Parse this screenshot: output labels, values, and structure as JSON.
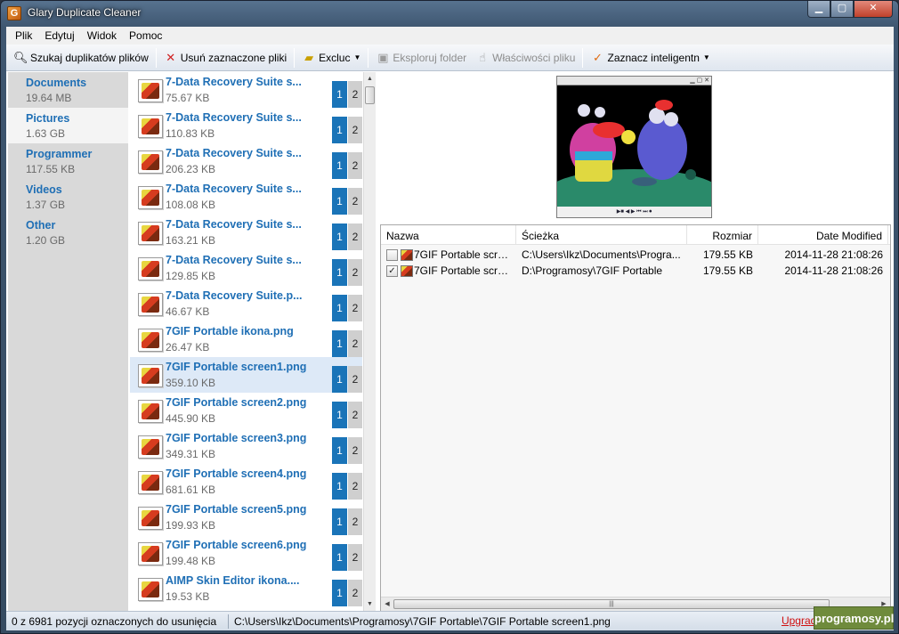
{
  "window": {
    "title": "Glary Duplicate Cleaner",
    "icon": "app-icon"
  },
  "menu": [
    "Plik",
    "Edytuj",
    "Widok",
    "Pomoc"
  ],
  "toolbar": {
    "search": "Szukaj duplikatów plików",
    "delete": "Usuń zaznaczone pliki",
    "exclude": "Excluc",
    "explore": "Eksploruj folder",
    "properties": "Właściwości pliku",
    "smart_select": "Zaznacz inteligentn"
  },
  "categories": [
    {
      "name": "Documents",
      "size": "19.64 MB"
    },
    {
      "name": "Pictures",
      "size": "1.63 GB"
    },
    {
      "name": "Programmer",
      "size": "117.55 KB"
    },
    {
      "name": "Videos",
      "size": "1.37 GB"
    },
    {
      "name": "Other",
      "size": "1.20 GB"
    }
  ],
  "files": [
    {
      "name": "7-Data Recovery Suite s...",
      "size": "75.67 KB",
      "c1": "1",
      "c2": "2"
    },
    {
      "name": "7-Data Recovery Suite s...",
      "size": "110.83 KB",
      "c1": "1",
      "c2": "2"
    },
    {
      "name": "7-Data Recovery Suite s...",
      "size": "206.23 KB",
      "c1": "1",
      "c2": "2"
    },
    {
      "name": "7-Data Recovery Suite s...",
      "size": "108.08 KB",
      "c1": "1",
      "c2": "2"
    },
    {
      "name": "7-Data Recovery Suite s...",
      "size": "163.21 KB",
      "c1": "1",
      "c2": "2"
    },
    {
      "name": "7-Data Recovery Suite s...",
      "size": "129.85 KB",
      "c1": "1",
      "c2": "2"
    },
    {
      "name": "7-Data Recovery Suite.p...",
      "size": "46.67 KB",
      "c1": "1",
      "c2": "2"
    },
    {
      "name": "7GIF Portable ikona.png",
      "size": "26.47 KB",
      "c1": "1",
      "c2": "2"
    },
    {
      "name": "7GIF Portable screen1.png",
      "size": "359.10 KB",
      "c1": "1",
      "c2": "2"
    },
    {
      "name": "7GIF Portable screen2.png",
      "size": "445.90 KB",
      "c1": "1",
      "c2": "2"
    },
    {
      "name": "7GIF Portable screen3.png",
      "size": "349.31 KB",
      "c1": "1",
      "c2": "2"
    },
    {
      "name": "7GIF Portable screen4.png",
      "size": "681.61 KB",
      "c1": "1",
      "c2": "2"
    },
    {
      "name": "7GIF Portable screen5.png",
      "size": "199.93 KB",
      "c1": "1",
      "c2": "2"
    },
    {
      "name": "7GIF Portable screen6.png",
      "size": "199.48 KB",
      "c1": "1",
      "c2": "2"
    },
    {
      "name": "AIMP Skin Editor ikona....",
      "size": "19.53 KB",
      "c1": "1",
      "c2": "2"
    }
  ],
  "details": {
    "headers": {
      "name": "Nazwa",
      "path": "Ścieżka",
      "size": "Rozmiar",
      "date": "Date Modified"
    },
    "rows": [
      {
        "checked": "",
        "name": "7GIF Portable scre...",
        "path": "C:\\Users\\Ikz\\Documents\\Progra...",
        "size": "179.55 KB",
        "date": "2014-11-28 21:08:26"
      },
      {
        "checked": "✓",
        "name": "7GIF Portable scre...",
        "path": "D:\\Programosy\\7GIF Portable",
        "size": "179.55 KB",
        "date": "2014-11-28 21:08:26"
      }
    ]
  },
  "status": {
    "selection": "0 z 6981 pozycji oznaczonych do usunięcia",
    "path": "C:\\Users\\Ikz\\Documents\\Programosy\\7GIF Portable\\7GIF Portable screen1.png",
    "upgrade": "Upgrade",
    "watermark": "programosy.pl"
  }
}
